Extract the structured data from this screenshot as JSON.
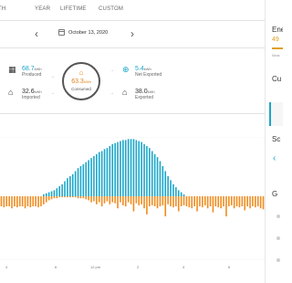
{
  "tabs": [
    "TH",
    "YEAR",
    "LIFETIME",
    "CUSTOM"
  ],
  "date": "October 13, 2020",
  "stats": {
    "produced": {
      "value": "68.7",
      "unit": "kWh",
      "label": "Produced"
    },
    "imported": {
      "value": "32.6",
      "unit": "kWh",
      "label": "Imported"
    },
    "consumed": {
      "value": "63.3",
      "unit": "kWh",
      "label": "Consumed"
    },
    "net_exported": {
      "value": "5.4",
      "unit": "kWh",
      "label": "Net Exported"
    },
    "exported": {
      "value": "38.0",
      "unit": "kWh",
      "label": "Exported"
    }
  },
  "axis_ticks": [
    "4",
    "6",
    "12 pm",
    "2",
    "4",
    "6"
  ],
  "side": {
    "title": "Ene",
    "percent_text": "49",
    "percent_value": 0.49,
    "small_text": "Meas",
    "sections": [
      "Cu",
      "Sc",
      "G"
    ]
  },
  "colors": {
    "produced": "#1aa6c9",
    "consumed": "#f08c1e",
    "accent": "#1aa6c9"
  },
  "chart_data": {
    "type": "bar",
    "series": [
      {
        "name": "Produced",
        "values": [
          0,
          0,
          0,
          0,
          0,
          0,
          0,
          0,
          0,
          0,
          0,
          0,
          0,
          0,
          0,
          0,
          0.02,
          0.03,
          0.04,
          0.05,
          0.06,
          0.08,
          0.1,
          0.12,
          0.15,
          0.18,
          0.2,
          0.22,
          0.25,
          0.28,
          0.3,
          0.32,
          0.34,
          0.36,
          0.38,
          0.4,
          0.42,
          0.44,
          0.45,
          0.47,
          0.48,
          0.5,
          0.52,
          0.53,
          0.54,
          0.55,
          0.56,
          0.56,
          0.57,
          0.57,
          0.57,
          0.56,
          0.55,
          0.54,
          0.52,
          0.5,
          0.48,
          0.45,
          0.42,
          0.39,
          0.35,
          0.3,
          0.25,
          0.2,
          0.16,
          0.12,
          0.09,
          0.06,
          0.04,
          0.02,
          0,
          0,
          0,
          0,
          0,
          0,
          0,
          0,
          0,
          0,
          0,
          0,
          0,
          0,
          0,
          0,
          0,
          0,
          0,
          0,
          0,
          0,
          0,
          0,
          0,
          0,
          0,
          0,
          0,
          0
        ]
      },
      {
        "name": "Consumed",
        "values": [
          0.1,
          0.11,
          0.1,
          0.1,
          0.12,
          0.1,
          0.11,
          0.1,
          0.1,
          0.12,
          0.1,
          0.11,
          0.1,
          0.1,
          0.11,
          0.1,
          0.08,
          0.06,
          0.04,
          0.03,
          0.02,
          0.02,
          0.01,
          0.01,
          0.01,
          0.01,
          0.01,
          0.01,
          0.01,
          0.02,
          0.02,
          0.02,
          0.03,
          0.04,
          0.06,
          0.05,
          0.08,
          0.06,
          0.1,
          0.07,
          0.05,
          0.08,
          0.06,
          0.07,
          0.12,
          0.06,
          0.09,
          0.1,
          0.06,
          0.08,
          0.15,
          0.07,
          0.09,
          0.08,
          0.12,
          0.18,
          0.1,
          0.09,
          0.1,
          0.12,
          0.1,
          0.09,
          0.2,
          0.08,
          0.1,
          0.11,
          0.1,
          0.15,
          0.1,
          0.09,
          0.1,
          0.11,
          0.12,
          0.1,
          0.15,
          0.1,
          0.11,
          0.09,
          0.12,
          0.1,
          0.16,
          0.1,
          0.11,
          0.12,
          0.1,
          0.2,
          0.1,
          0.09,
          0.12,
          0.1,
          0.11,
          0.1,
          0.14,
          0.1,
          0.12,
          0.1,
          0.11,
          0.1,
          0.12,
          0.13
        ]
      }
    ]
  }
}
